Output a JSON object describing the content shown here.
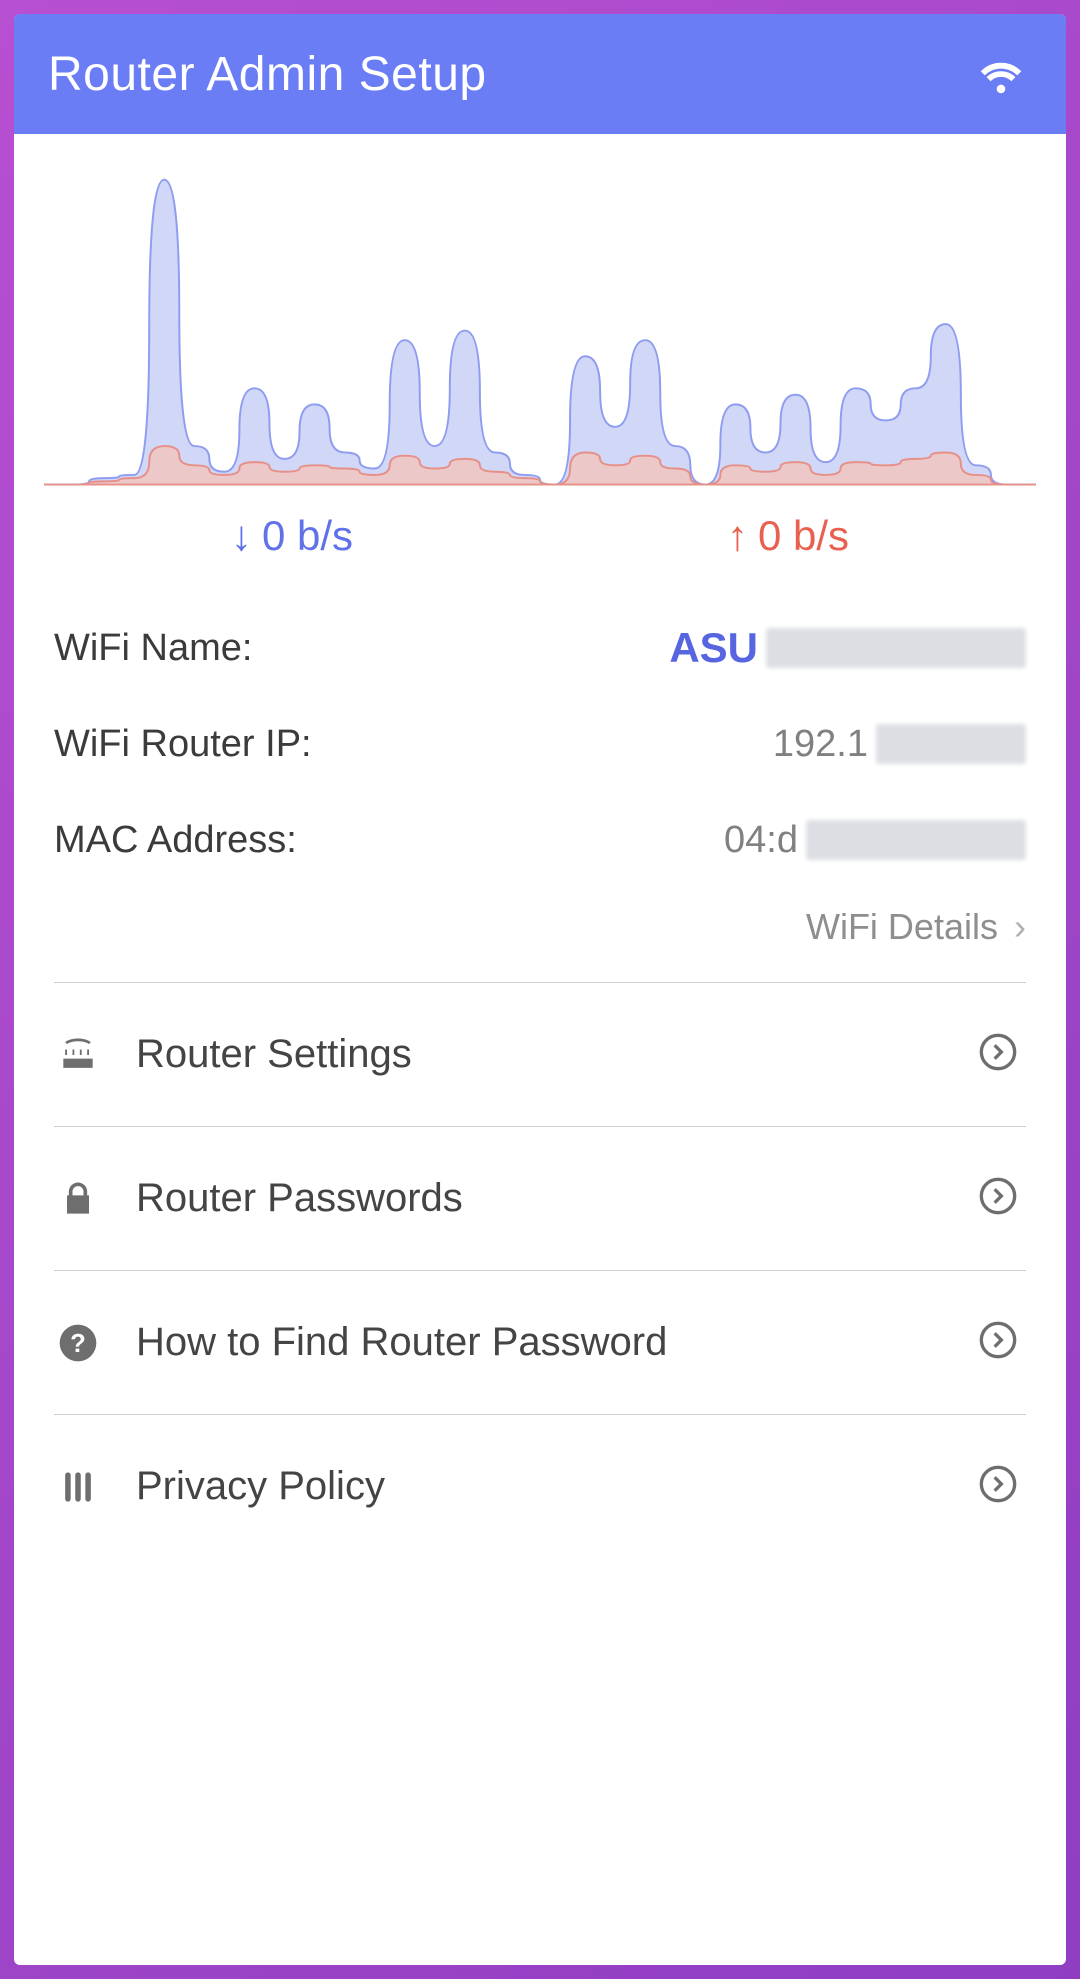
{
  "header": {
    "title": "Router Admin Setup"
  },
  "traffic": {
    "download": {
      "value": "0 b/s"
    },
    "upload": {
      "value": "0 b/s"
    }
  },
  "info": {
    "wifi_name_label": "WiFi Name:",
    "wifi_name_value_visible": "ASU",
    "router_ip_label": "WiFi Router IP:",
    "router_ip_value_visible": "192.1",
    "mac_label": "MAC Address:",
    "mac_value_visible": "04:d",
    "details_link": "WiFi Details"
  },
  "menu": [
    {
      "id": "router-settings",
      "label": "Router Settings"
    },
    {
      "id": "router-passwords",
      "label": "Router Passwords"
    },
    {
      "id": "find-password",
      "label": "How to Find Router Password"
    },
    {
      "id": "privacy-policy",
      "label": "Privacy Policy"
    }
  ],
  "chart_data": {
    "type": "area",
    "xlabel": "",
    "ylabel": "",
    "series": [
      {
        "name": "download",
        "color": "#8f9df0",
        "fill": "#c9d1f6",
        "values": [
          0,
          0,
          2,
          3,
          95,
          12,
          4,
          30,
          8,
          25,
          10,
          5,
          45,
          12,
          48,
          10,
          3,
          0,
          40,
          18,
          45,
          12,
          0,
          25,
          10,
          28,
          7,
          30,
          20,
          30,
          50,
          6,
          0,
          0
        ]
      },
      {
        "name": "upload",
        "color": "#e69088",
        "fill": "#f1c5c1",
        "values": [
          0,
          0,
          1,
          2,
          12,
          6,
          3,
          7,
          4,
          6,
          5,
          3,
          9,
          5,
          8,
          4,
          2,
          0,
          10,
          6,
          9,
          5,
          0,
          6,
          4,
          7,
          3,
          7,
          6,
          8,
          10,
          3,
          0,
          0
        ]
      }
    ],
    "ylim": [
      0,
      100
    ]
  }
}
